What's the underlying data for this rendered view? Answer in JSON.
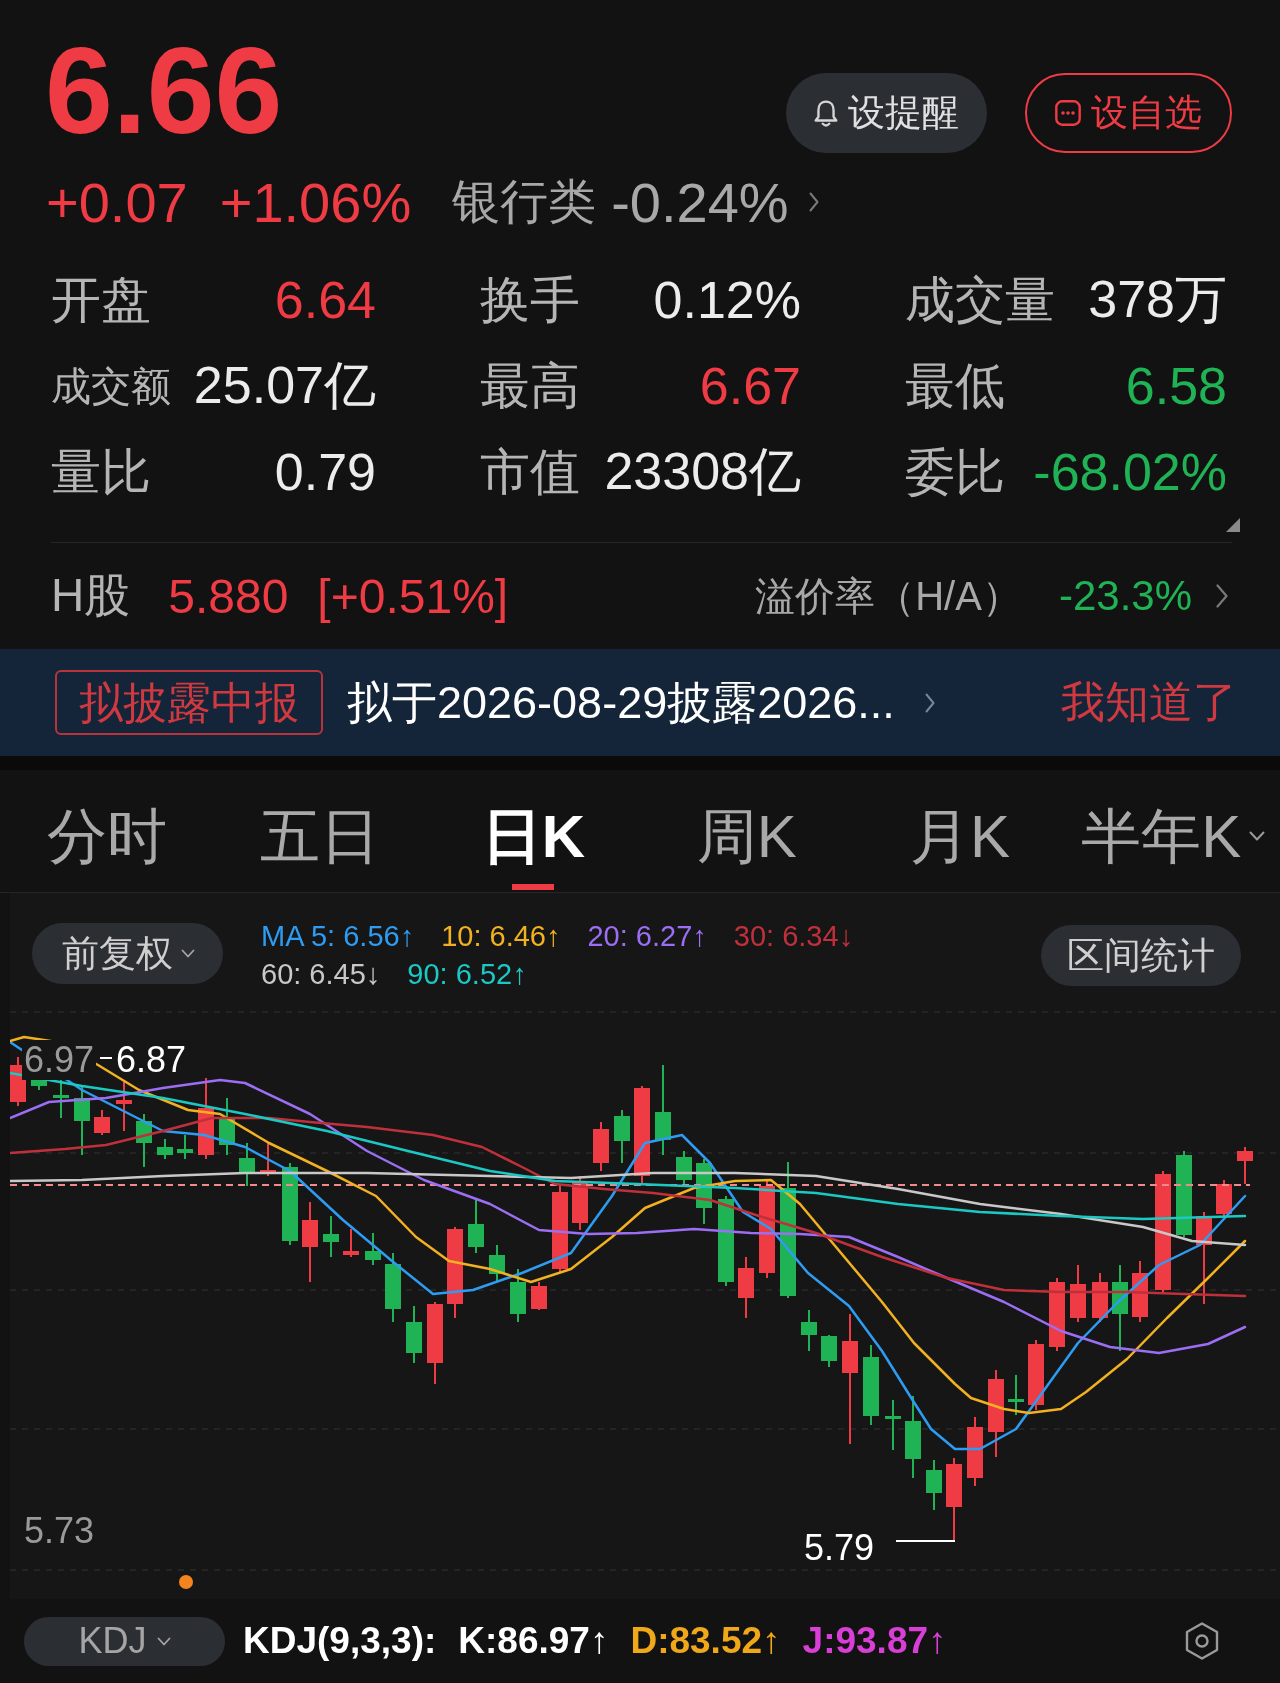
{
  "quote": {
    "price": "6.66",
    "change": "+0.07",
    "change_percent": "+1.06%",
    "rising": true
  },
  "sector": {
    "name": "银行类",
    "change": "-0.24%"
  },
  "actions": [
    {
      "kind": "alert",
      "label": "设提醒"
    },
    {
      "kind": "watchlist",
      "label": "设自选"
    }
  ],
  "stats": [
    {
      "label": "开盘",
      "value": "6.64",
      "color": "#ee3b44",
      "kind": "standard"
    },
    {
      "label": "换手",
      "value": "0.12%",
      "color": "#ececec",
      "kind": "standard"
    },
    {
      "label": "成交量",
      "value": "378万",
      "color": "#ececec",
      "kind": "standard"
    },
    {
      "label": "成交额",
      "value": "25.07亿",
      "color": "#ececec",
      "kind": "compact"
    },
    {
      "label": "最高",
      "value": "6.67",
      "color": "#ee3b44",
      "kind": "standard"
    },
    {
      "label": "最低",
      "value": "6.58",
      "color": "#1fb356",
      "kind": "standard"
    },
    {
      "label": "量比",
      "value": "0.79",
      "color": "#ececec",
      "kind": "standard"
    },
    {
      "label": "市值",
      "value": "23308亿",
      "color": "#ececec",
      "kind": "standard"
    },
    {
      "label": "委比",
      "value": "-68.02%",
      "color": "#1fb356",
      "kind": "standard"
    }
  ],
  "h_share": {
    "label": "H股",
    "price": "5.880",
    "change_percent": "[+0.51%]",
    "rising": true,
    "premium_label": "溢价率（H/A）",
    "premium": "-23.3%",
    "premium_rising": false
  },
  "notice": {
    "tag": "拟披露中报",
    "text": "拟于2026-08-29披露2026...",
    "action": "我知道了"
  },
  "chart_tabs": [
    {
      "label": "分时",
      "selected": false,
      "has_menu": false
    },
    {
      "label": "五日",
      "selected": false,
      "has_menu": false
    },
    {
      "label": "日K",
      "selected": true,
      "has_menu": false
    },
    {
      "label": "周K",
      "selected": false,
      "has_menu": false
    },
    {
      "label": "月K",
      "selected": false,
      "has_menu": false
    },
    {
      "label": "半年K",
      "selected": false,
      "has_menu": true
    }
  ],
  "adjustment": {
    "label": "前复权"
  },
  "ma_legend": [
    {
      "text": "MA 5: 6.56↑",
      "color": "#2d9cf2"
    },
    {
      "text": "10: 6.46↑",
      "color": "#f2b11f"
    },
    {
      "text": "20: 6.27↑",
      "color": "#9b6ef3"
    },
    {
      "text": "30: 6.34↓",
      "color": "#c0303a"
    },
    {
      "text": "60: 6.45↓",
      "color": "#c8c8c8"
    },
    {
      "text": "90: 6.52↑",
      "color": "#1bc9c4"
    }
  ],
  "range_stats": {
    "label": "区间统计"
  },
  "chart": {
    "top_label": "6.97",
    "high_label": "6.87",
    "bottom_label": "5.73",
    "low_label": "5.79"
  },
  "indicator": {
    "selector": "KDJ",
    "name": "KDJ(9,3,3):",
    "values": [
      {
        "text": "K:86.97↑",
        "color": "#ffffff"
      },
      {
        "text": "D:83.52↑",
        "color": "#f0a81a"
      },
      {
        "text": "J:93.87↑",
        "color": "#d93fd6"
      }
    ]
  }
}
